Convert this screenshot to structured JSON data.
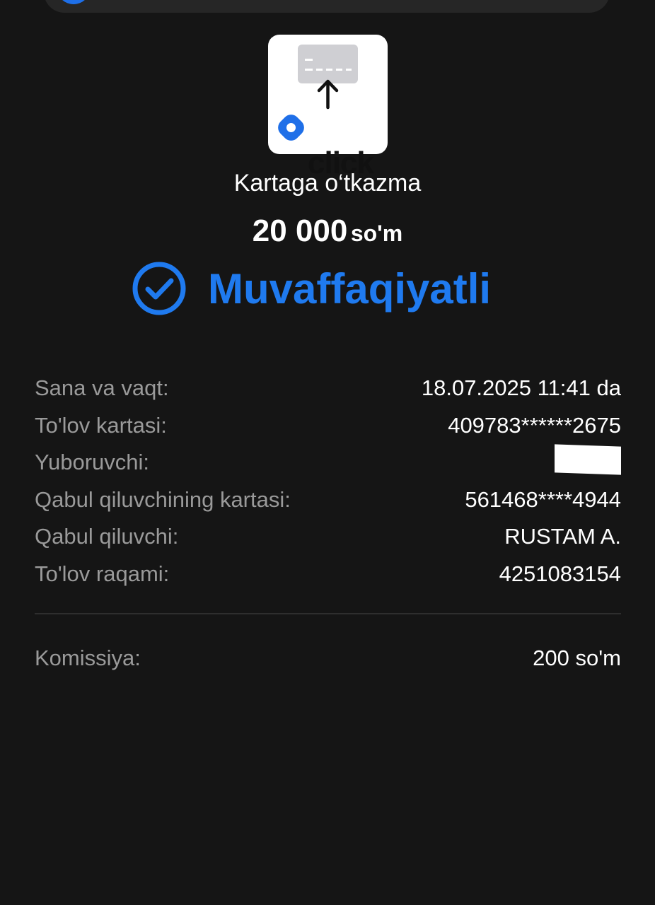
{
  "transfer": {
    "brand": "click",
    "title": "Kartaga o‘tkazma",
    "amount": "20 000",
    "currency": "so'm",
    "status": "Muvaffaqiyatli"
  },
  "details": [
    {
      "label": "Sana va vaqt:",
      "value": "18.07.2025 11:41 da"
    },
    {
      "label": "To'lov kartasi:",
      "value": "409783******2675"
    },
    {
      "label": "Yuboruvchi:",
      "value": ""
    },
    {
      "label": "Qabul qiluvchining kartasi:",
      "value": "561468****4944"
    },
    {
      "label": "Qabul qiluvchi:",
      "value": "RUSTAM A."
    },
    {
      "label": "To'lov raqami:",
      "value": "4251083154"
    }
  ],
  "fee": {
    "label": "Komissiya:",
    "value": "200 so'm"
  },
  "colors": {
    "background": "#151515",
    "accent": "#1f7aef",
    "label": "#9a9a9a",
    "value": "#ffffff"
  },
  "icons": [
    "card-transfer-icon",
    "click-logo-icon",
    "check-circle-icon"
  ]
}
